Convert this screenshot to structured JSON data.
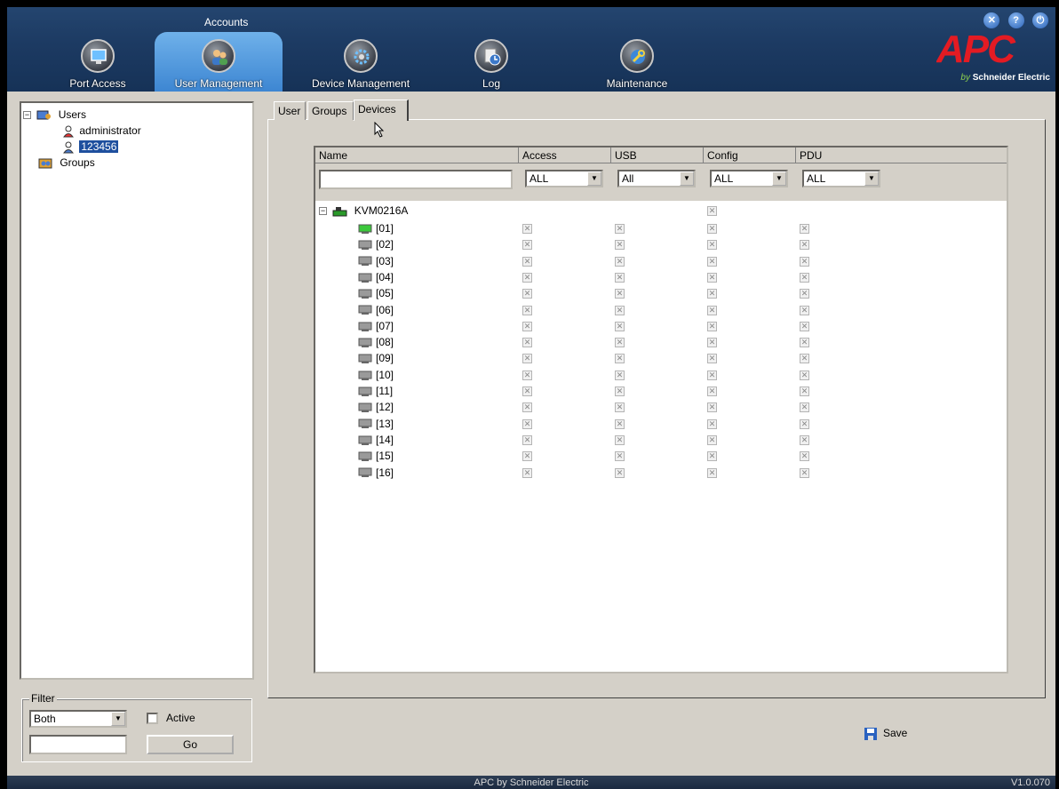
{
  "header": {
    "section_label": "Accounts",
    "nav": [
      {
        "label": "Port Access",
        "icon": "monitor-icon",
        "active": false
      },
      {
        "label": "User Management",
        "icon": "users-icon",
        "active": true
      },
      {
        "label": "Device Management",
        "icon": "gear-icon",
        "active": false
      },
      {
        "label": "Log",
        "icon": "log-clock-icon",
        "active": false
      },
      {
        "label": "Maintenance",
        "icon": "wrench-icon",
        "active": false
      }
    ],
    "brand_logo": "APC",
    "brand_sub_by": "by",
    "brand_sub": "Schneider Electric",
    "colors": {
      "header_bg": "#1c3a62",
      "active_tab": "#4a92dc",
      "logo_red": "#e31b23"
    }
  },
  "tree": {
    "users_label": "Users",
    "users": [
      "administrator",
      "123456"
    ],
    "selected_user": "123456",
    "groups_label": "Groups"
  },
  "filter": {
    "legend": "Filter",
    "select_value": "Both",
    "active_label": "Active",
    "search_value": "",
    "go_label": "Go"
  },
  "tabs": [
    {
      "label": "User",
      "active": false
    },
    {
      "label": "Groups",
      "active": false
    },
    {
      "label": "Devices",
      "active": true
    }
  ],
  "device_table": {
    "columns": [
      "Name",
      "Access",
      "USB",
      "Config",
      "PDU"
    ],
    "filters": {
      "name": "",
      "access": "ALL",
      "usb": "All",
      "config": "ALL",
      "pdu": "ALL"
    },
    "root": {
      "name": "KVM0216A",
      "config_checked": false
    },
    "ports": [
      "[01]",
      "[02]",
      "[03]",
      "[04]",
      "[05]",
      "[06]",
      "[07]",
      "[08]",
      "[09]",
      "[10]",
      "[11]",
      "[12]",
      "[13]",
      "[14]",
      "[15]",
      "[16]"
    ],
    "active_port": "[01]"
  },
  "save_label": "Save",
  "footer": {
    "center": "APC by Schneider Electric",
    "version": "V1.0.070"
  }
}
